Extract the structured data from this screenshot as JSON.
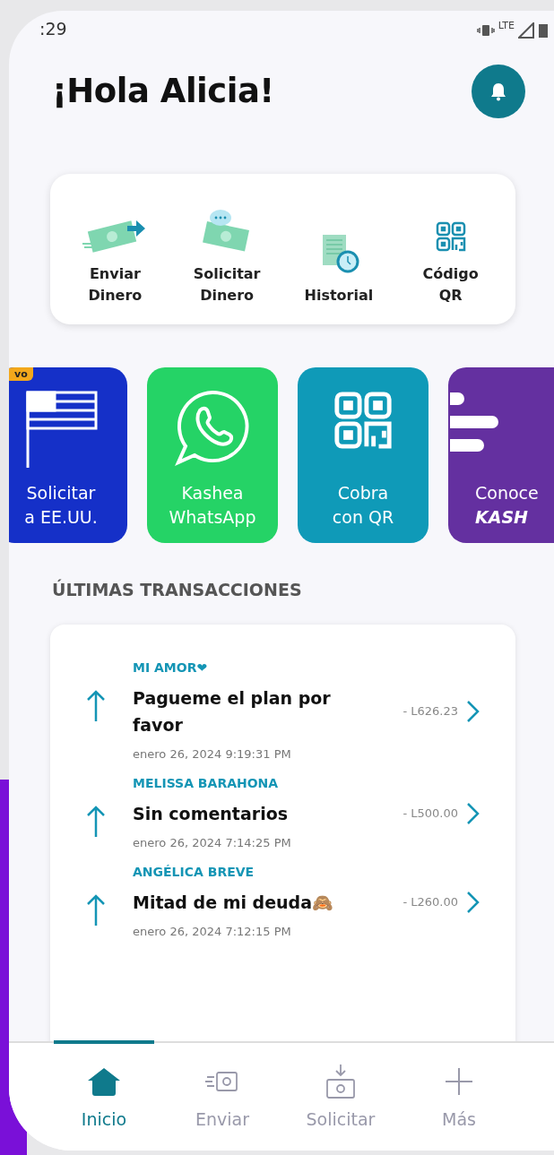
{
  "status_bar": {
    "time": ":29",
    "network": "LTE"
  },
  "greeting": "¡Hola Alicia!",
  "quick_actions": [
    {
      "kind": "send",
      "lines": [
        "Enviar",
        "Dinero"
      ]
    },
    {
      "kind": "request",
      "lines": [
        "Solicitar",
        "Dinero"
      ]
    },
    {
      "kind": "history",
      "lines": [
        "Historial"
      ]
    },
    {
      "kind": "qr",
      "lines": [
        "Código",
        "QR"
      ]
    }
  ],
  "promos": [
    {
      "kind": "flag",
      "color": "#1530c8",
      "badge": "vo",
      "lines": [
        "Solicitar",
        "a EE.UU."
      ]
    },
    {
      "kind": "whatsapp",
      "color": "#25d366",
      "lines": [
        "Kashea",
        "WhatsApp"
      ]
    },
    {
      "kind": "qr",
      "color": "#0f9ab8",
      "lines": [
        "Cobra",
        "con QR"
      ]
    },
    {
      "kind": "lines",
      "color": "#6430a0",
      "lines": [
        "Conoce",
        "**KASH**"
      ]
    }
  ],
  "transactions_title": "ÚLTIMAS TRANSACCIONES",
  "transactions": [
    {
      "name": "MI AMOR❤",
      "title": "Pagueme el plan por favor",
      "amount": "- L626.23",
      "date": "enero 26, 2024 9:19:31 PM"
    },
    {
      "name": "MELISSA BARAHONA",
      "title": "Sin comentarios",
      "amount": "- L500.00",
      "date": "enero 26, 2024 7:14:25 PM"
    },
    {
      "name": "ANGÉLICA BREVE",
      "title": "Mitad de mi deuda🙈",
      "amount": "- L260.00",
      "date": "enero 26, 2024 7:12:15 PM"
    }
  ],
  "bottom_nav": [
    {
      "kind": "home",
      "label": "Inicio",
      "selected": true
    },
    {
      "kind": "send",
      "label": "Enviar",
      "selected": false
    },
    {
      "kind": "request",
      "label": "Solicitar",
      "selected": false
    },
    {
      "kind": "more",
      "label": "Más",
      "selected": false
    }
  ]
}
